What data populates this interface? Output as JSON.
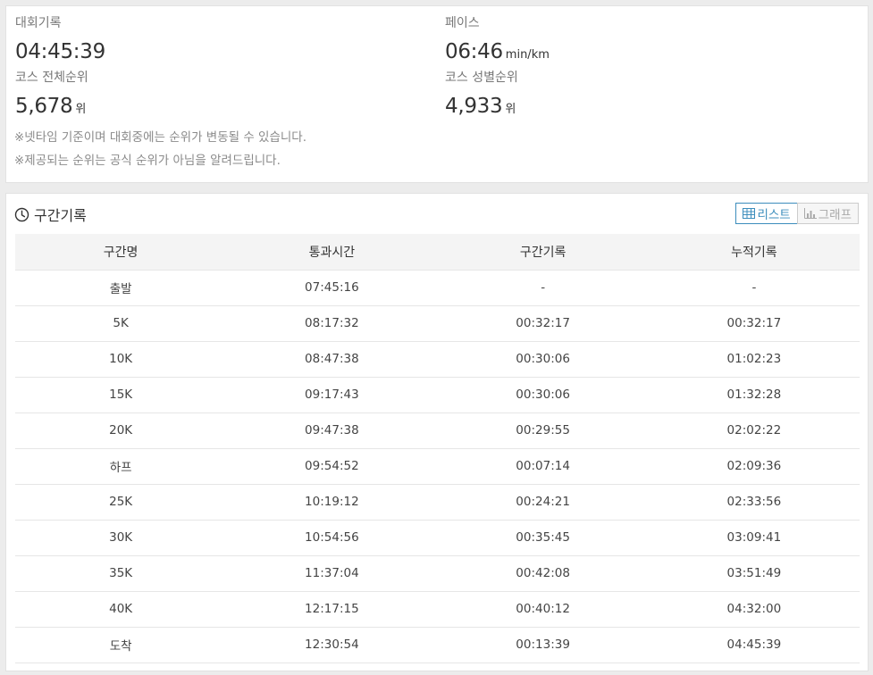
{
  "summary": {
    "record": {
      "label": "대회기록",
      "value": "04:45:39",
      "unit": ""
    },
    "pace": {
      "label": "페이스",
      "value": "06:46",
      "unit": "min/km"
    },
    "overall_rank": {
      "label": "코스 전체순위",
      "value": "5,678",
      "unit": "위"
    },
    "gender_rank": {
      "label": "코스 성별순위",
      "value": "4,933",
      "unit": "위"
    },
    "notes": [
      "※넷타임 기준이며 대회중에는 순위가 변동될 수 있습니다.",
      "※제공되는 순위는 공식 순위가 아님을 알려드립니다."
    ]
  },
  "splits": {
    "title": "구간기록",
    "icon": "clock-icon",
    "view_toggle": {
      "list_label": "리스트",
      "list_icon": "table-icon",
      "graph_label": "그래프",
      "graph_icon": "bar-chart-icon",
      "active": "list"
    },
    "columns": [
      "구간명",
      "통과시간",
      "구간기록",
      "누적기록"
    ],
    "rows": [
      [
        "출발",
        "07:45:16",
        "-",
        "-"
      ],
      [
        "5K",
        "08:17:32",
        "00:32:17",
        "00:32:17"
      ],
      [
        "10K",
        "08:47:38",
        "00:30:06",
        "01:02:23"
      ],
      [
        "15K",
        "09:17:43",
        "00:30:06",
        "01:32:28"
      ],
      [
        "20K",
        "09:47:38",
        "00:29:55",
        "02:02:22"
      ],
      [
        "하프",
        "09:54:52",
        "00:07:14",
        "02:09:36"
      ],
      [
        "25K",
        "10:19:12",
        "00:24:21",
        "02:33:56"
      ],
      [
        "30K",
        "10:54:56",
        "00:35:45",
        "03:09:41"
      ],
      [
        "35K",
        "11:37:04",
        "00:42:08",
        "03:51:49"
      ],
      [
        "40K",
        "12:17:15",
        "00:40:12",
        "04:32:00"
      ],
      [
        "도착",
        "12:30:54",
        "00:13:39",
        "04:45:39"
      ]
    ]
  },
  "colors": {
    "accent": "#3c8dbc",
    "background": "#ececec",
    "card": "#ffffff",
    "header_row": "#f4f4f4"
  }
}
